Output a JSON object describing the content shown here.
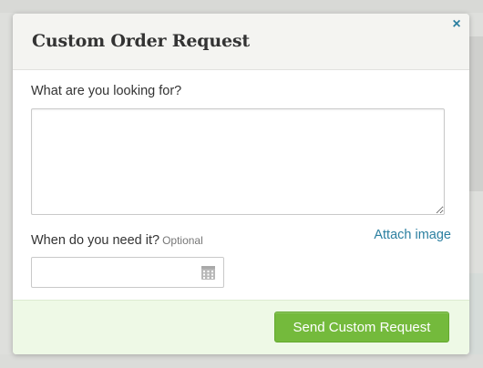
{
  "modal": {
    "title": "Custom Order Request",
    "close_icon": "close-icon",
    "looking_label": "What are you looking for?",
    "looking_value": "",
    "when_label": "When do you need it?",
    "optional_label": "Optional",
    "date_value": "",
    "calendar_icon": "calendar-icon",
    "attach_label": "Attach image",
    "send_label": "Send Custom Request"
  },
  "colors": {
    "accent_link": "#2b7fa0",
    "button_green": "#74ba3c",
    "footer_bg": "#eef9e6",
    "header_bg": "#f4f4f1"
  }
}
